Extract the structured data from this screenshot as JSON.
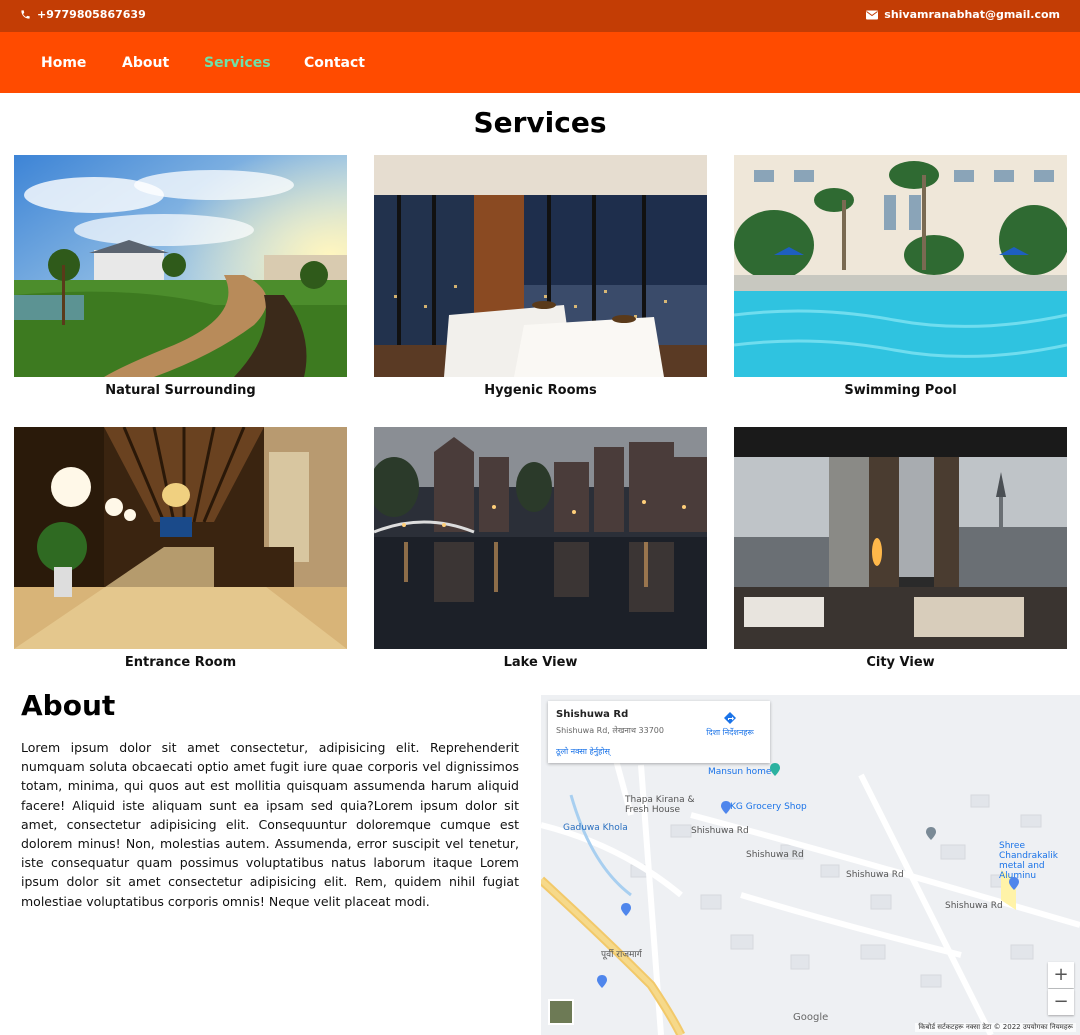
{
  "topbar": {
    "phone": "+9779805867639",
    "email": "shivamranabhat@gmail.com"
  },
  "nav": {
    "items": [
      "Home",
      "About",
      "Services",
      "Contact"
    ],
    "active": "Services"
  },
  "services": {
    "title": "Services",
    "cards": [
      {
        "caption": "Natural Surrounding"
      },
      {
        "caption": "Hygenic Rooms"
      },
      {
        "caption": "Swimming Pool"
      },
      {
        "caption": "Entrance Room"
      },
      {
        "caption": "Lake View"
      },
      {
        "caption": "City View"
      }
    ]
  },
  "about": {
    "title": "About",
    "text": "Lorem ipsum dolor sit amet consectetur, adipisicing elit. Reprehenderit numquam soluta obcaecati optio amet fugit iure quae corporis vel dignissimos totam, minima, qui quos aut est mollitia quisquam assumenda harum aliquid facere! Aliquid iste aliquam sunt ea ipsam sed quia?Lorem ipsum dolor sit amet, consectetur adipisicing elit. Consequuntur doloremque cumque est dolorem minus! Non, molestias autem. Assumenda, error suscipit vel tenetur, iste consequatur quam possimus voluptatibus natus laborum itaque Lorem ipsum dolor sit amet consectetur adipisicing elit. Rem, quidem nihil fugiat molestiae voluptatibus corporis omnis! Neque velit placeat modi."
  },
  "map": {
    "place_name": "Shishuwa Rd",
    "address": "Shishuwa Rd, लेखनाथ 33700",
    "directions": "दिशा निर्देशनहरू",
    "larger_map": "ठूलो नक्सा हेर्नुहोस्",
    "poi_mansun": "Mansun home",
    "poi_thapa": "Thapa Kirana & Fresh House",
    "poi_kg": "KG Grocery Shop",
    "poi_shree": "Shree Chandrakalik metal and Aluminu",
    "road_shishuwa": "Shishuwa Rd",
    "road_gaduwa": "Gaduwa Khola",
    "road_purbi": "पूर्वी राजमार्ग",
    "google": "Google",
    "footer": "किबोर्ड सर्टकटहरू   नक्सा डेटा © 2022   उपयोगका नियमहरू",
    "zoom_in": "+",
    "zoom_out": "−"
  }
}
